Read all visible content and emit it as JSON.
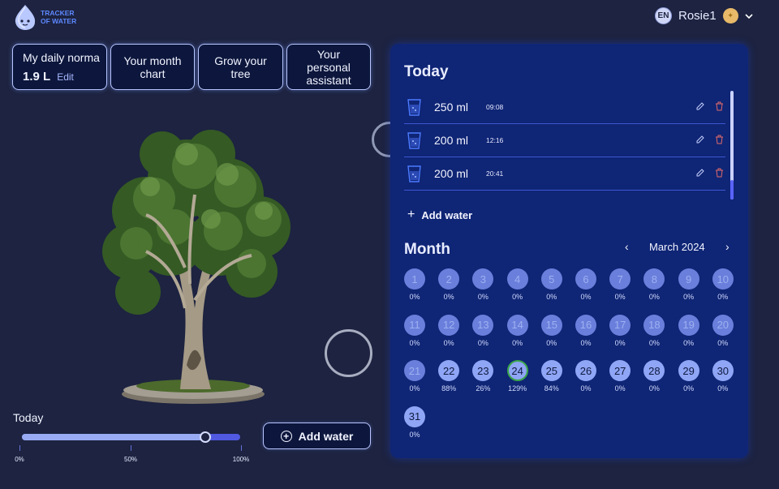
{
  "header": {
    "logo_line1": "TRACKER",
    "logo_line2": "OF WATER",
    "lang": "EN",
    "username": "Rosie1"
  },
  "tabs": {
    "norma_title": "My daily norma",
    "norma_value": "1.9 L",
    "norma_edit": "Edit",
    "month_line1": "Your month",
    "month_line2": "chart",
    "tree_line1": "Grow your",
    "tree_line2": "tree",
    "assistant_line1": "Your",
    "assistant_line2": "personal",
    "assistant_line3": "assistant"
  },
  "today_progress": {
    "label": "Today",
    "percent": 84,
    "ticks": [
      "0%",
      "50%",
      "100%"
    ]
  },
  "main_add_water": "Add water",
  "panel": {
    "today_title": "Today",
    "entries": [
      {
        "amount": "250 ml",
        "time": "09:08"
      },
      {
        "amount": "200 ml",
        "time": "12:16"
      },
      {
        "amount": "200 ml",
        "time": "20:41"
      }
    ],
    "add_water": "Add water",
    "month_title": "Month",
    "month_label": "March 2024",
    "prev": "‹",
    "next": "›",
    "days": [
      {
        "d": "1",
        "p": "0%",
        "s": "faded"
      },
      {
        "d": "2",
        "p": "0%",
        "s": "faded"
      },
      {
        "d": "3",
        "p": "0%",
        "s": "faded"
      },
      {
        "d": "4",
        "p": "0%",
        "s": "faded"
      },
      {
        "d": "5",
        "p": "0%",
        "s": "faded"
      },
      {
        "d": "6",
        "p": "0%",
        "s": "faded"
      },
      {
        "d": "7",
        "p": "0%",
        "s": "faded"
      },
      {
        "d": "8",
        "p": "0%",
        "s": "faded"
      },
      {
        "d": "9",
        "p": "0%",
        "s": "faded"
      },
      {
        "d": "10",
        "p": "0%",
        "s": "faded"
      },
      {
        "d": "11",
        "p": "0%",
        "s": "faded"
      },
      {
        "d": "12",
        "p": "0%",
        "s": "faded"
      },
      {
        "d": "13",
        "p": "0%",
        "s": "faded"
      },
      {
        "d": "14",
        "p": "0%",
        "s": "faded"
      },
      {
        "d": "15",
        "p": "0%",
        "s": "faded"
      },
      {
        "d": "16",
        "p": "0%",
        "s": "faded"
      },
      {
        "d": "17",
        "p": "0%",
        "s": "faded"
      },
      {
        "d": "18",
        "p": "0%",
        "s": "faded"
      },
      {
        "d": "19",
        "p": "0%",
        "s": "faded"
      },
      {
        "d": "20",
        "p": "0%",
        "s": "faded"
      },
      {
        "d": "21",
        "p": "0%",
        "s": "faded"
      },
      {
        "d": "22",
        "p": "88%",
        "s": "filled"
      },
      {
        "d": "23",
        "p": "26%",
        "s": "filled"
      },
      {
        "d": "24",
        "p": "129%",
        "s": "today"
      },
      {
        "d": "25",
        "p": "84%",
        "s": "filled"
      },
      {
        "d": "26",
        "p": "0%",
        "s": "filled"
      },
      {
        "d": "27",
        "p": "0%",
        "s": "filled"
      },
      {
        "d": "28",
        "p": "0%",
        "s": "filled"
      },
      {
        "d": "29",
        "p": "0%",
        "s": "filled"
      },
      {
        "d": "30",
        "p": "0%",
        "s": "filled"
      },
      {
        "d": "31",
        "p": "0%",
        "s": "filled"
      }
    ]
  },
  "icons": {
    "logo": "water-drop-mascot-icon",
    "avatar": "user-avatar-icon",
    "dropdown": "chevron-down-icon",
    "glass": "water-glass-icon",
    "edit": "pencil-icon",
    "delete": "trash-icon",
    "add": "plus-icon"
  },
  "colors": {
    "background": "#1d2340",
    "panel": "#0f2575",
    "accent": "#5d88ff",
    "progress": "#5059e0",
    "today_ring": "#3aa64a",
    "delete": "#e06a6a"
  }
}
